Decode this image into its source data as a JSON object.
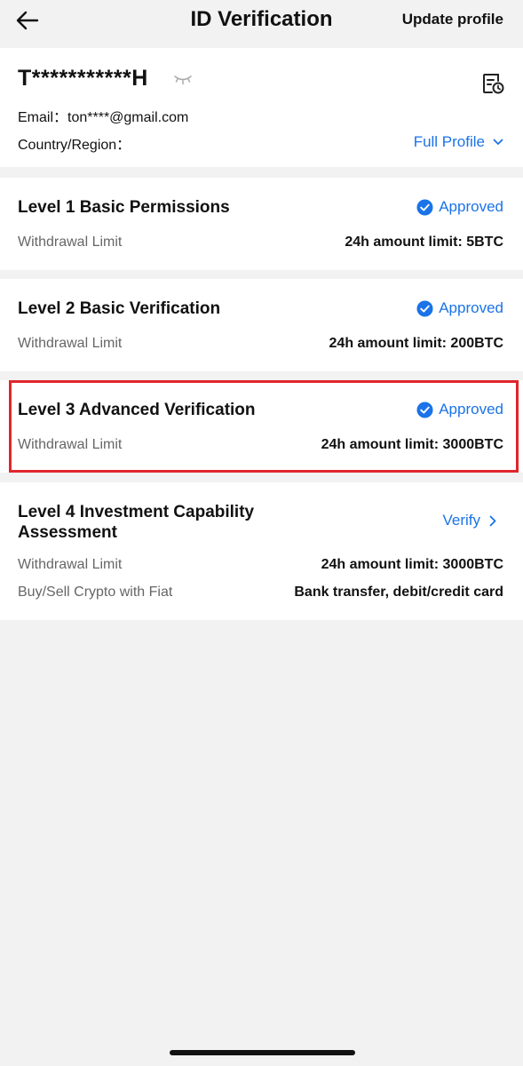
{
  "header": {
    "title": "ID Verification",
    "update_profile": "Update profile",
    "back_icon": "arrow-left-icon"
  },
  "profile": {
    "masked_name": "T***********H",
    "email_label": "Email：",
    "email_value": "ton****@gmail.com",
    "country_label": "Country/Region：",
    "full_profile": "Full Profile",
    "icons": [
      "eye-closed-icon",
      "document-history-icon",
      "chevron-down-icon"
    ]
  },
  "levels": [
    {
      "title": "Level 1 Basic Permissions",
      "status": "Approved",
      "limit_label": "Withdrawal Limit",
      "limit_value": "24h amount limit: 5BTC"
    },
    {
      "title": "Level 2 Basic Verification",
      "status": "Approved",
      "limit_label": "Withdrawal Limit",
      "limit_value": "24h amount limit: 200BTC"
    },
    {
      "title": "Level 3 Advanced Verification",
      "status": "Approved",
      "limit_label": "Withdrawal Limit",
      "limit_value": "24h amount limit: 3000BTC"
    },
    {
      "title": "Level 4 Investment Capability Assessment",
      "action": "Verify",
      "limit_label": "Withdrawal Limit",
      "limit_value": "24h amount limit: 3000BTC",
      "fiat_label": "Buy/Sell Crypto with Fiat",
      "fiat_value": "Bank transfer, debit/credit card"
    }
  ],
  "colors": {
    "accent": "#1a73e8",
    "highlight": "#e0262c",
    "background": "#f2f2f2"
  }
}
